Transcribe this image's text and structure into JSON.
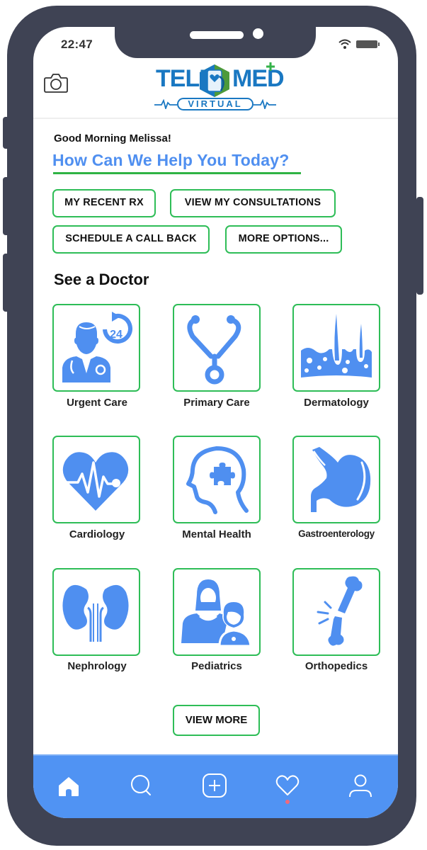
{
  "status_bar": {
    "time": "22:47",
    "wifi_icon": "wifi-icon",
    "battery_icon": "battery-icon"
  },
  "header": {
    "camera_icon": "camera-icon",
    "logo": {
      "word1": "TELE",
      "word2": "MED",
      "tagline": "VIRTUAL"
    }
  },
  "greeting": "Good Morning Melissa!",
  "help_title": "How Can We Help You Today?",
  "quick_actions": [
    {
      "label": "MY RECENT RX"
    },
    {
      "label": "VIEW MY CONSULTATIONS"
    },
    {
      "label": "SCHEDULE A CALL BACK"
    },
    {
      "label": "MORE OPTIONS..."
    }
  ],
  "section_title": "See a Doctor",
  "specialties": [
    {
      "label": "Urgent Care",
      "icon": "urgent-care-doctor-24-icon"
    },
    {
      "label": "Primary Care",
      "icon": "stethoscope-icon"
    },
    {
      "label": "Dermatology",
      "icon": "skin-hair-icon"
    },
    {
      "label": "Cardiology",
      "icon": "heart-pulse-icon"
    },
    {
      "label": "Mental Health",
      "icon": "head-puzzle-icon"
    },
    {
      "label": "Gastroenterology",
      "icon": "stomach-icon"
    },
    {
      "label": "Nephrology",
      "icon": "kidneys-icon"
    },
    {
      "label": "Pediatrics",
      "icon": "mother-child-icon"
    },
    {
      "label": "Orthopedics",
      "icon": "broken-bone-icon"
    }
  ],
  "view_more_label": "VIEW MORE",
  "tab_bar": {
    "items": [
      {
        "name": "home",
        "icon": "home-icon",
        "active": true
      },
      {
        "name": "search",
        "icon": "search-icon"
      },
      {
        "name": "add",
        "icon": "plus-square-icon"
      },
      {
        "name": "favorites",
        "icon": "heart-icon",
        "has_notification": true
      },
      {
        "name": "profile",
        "icon": "user-icon"
      }
    ]
  },
  "colors": {
    "accent_blue": "#4f8ff0",
    "tile_border_green": "#2ebd57",
    "tab_bar_bg": "#5093f3",
    "frame": "#3f4354",
    "notification_dot": "#f06a7c"
  }
}
